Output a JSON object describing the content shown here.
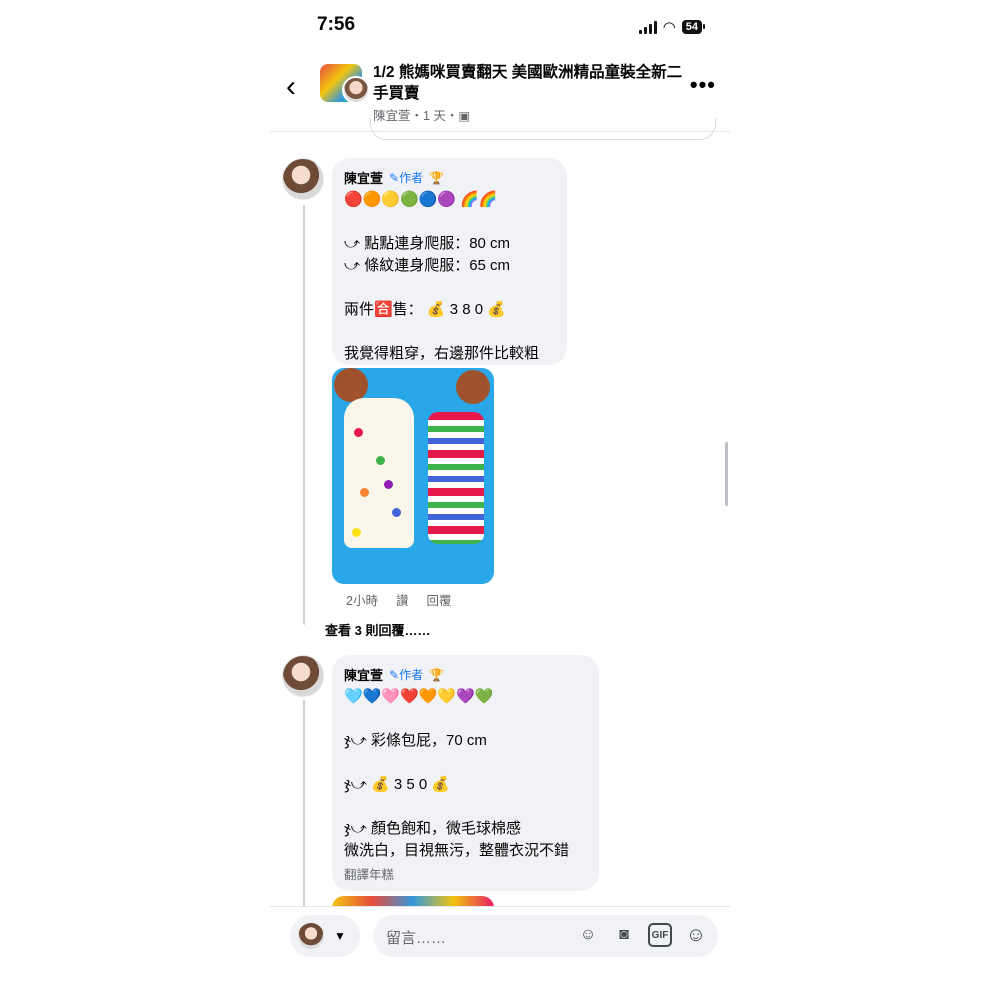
{
  "status": {
    "time": "7:56",
    "battery": "54"
  },
  "header": {
    "title": "1/2 熊媽咪買賣翻天 美國歐洲精品童裝全新二手買賣",
    "subtitle": "陳宜萱・1 天・"
  },
  "comments": [
    {
      "author": "陳宜萱",
      "badge": "作者",
      "text": "🔴🟠🟡🟢🔵🟣 🌈🌈\n\n⤻ 點點連身爬服：80 cm\n⤻ 條紋連身爬服：65 cm\n\n兩件🈴售： 💰 3 8 0 💰\n\n我覺得粗穿，右邊那件比較粗",
      "time": "2小時",
      "like": "讚",
      "reply": "回覆"
    },
    {
      "author": "陳宜萱",
      "badge": "作者",
      "text": "🩵💙🩷❤️🧡💛💜💚\n\nჯ⤻ 彩條包屁，70 cm\n\nჯ⤻ 💰 3 5 0 💰\n\nჯ⤻ 顏色飽和，微毛球棉感\n微洗白，目視無污，整體衣況不錯",
      "translate": "翻譯年糕"
    }
  ],
  "view_more": "查看 3 則回覆……",
  "composer": {
    "placeholder": "留言……"
  }
}
